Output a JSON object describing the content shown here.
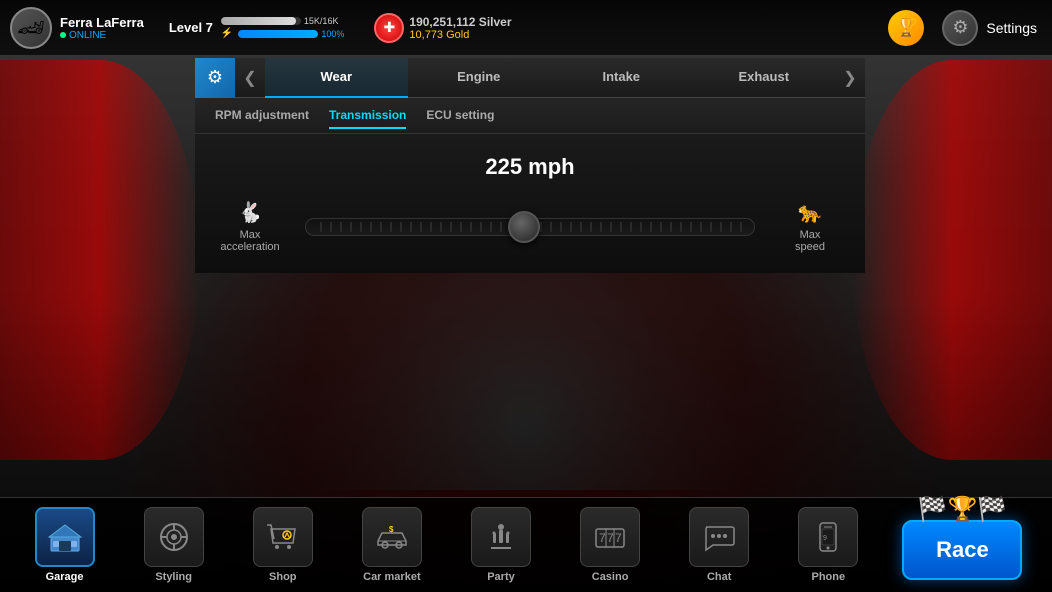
{
  "header": {
    "player": {
      "name": "Ferra LaFerra",
      "status": "ONLINE",
      "avatar_char": "🏎"
    },
    "level": {
      "label": "Level 7",
      "xp_current": "15K",
      "xp_max": "16K",
      "xp_percent": 94,
      "energy_percent": 100,
      "energy_label": "100%"
    },
    "currency": {
      "silver": "190,251,112 Silver",
      "gold": "10,773 Gold"
    },
    "settings_label": "Settings"
  },
  "tuning": {
    "gear_icon": "⚙",
    "tabs": [
      {
        "id": "wear",
        "label": "Wear",
        "active": true
      },
      {
        "id": "engine",
        "label": "Engine",
        "active": false
      },
      {
        "id": "intake",
        "label": "Intake",
        "active": false
      },
      {
        "id": "exhaust",
        "label": "Exhaust",
        "active": false
      }
    ],
    "sub_tabs": [
      {
        "id": "rpm",
        "label": "RPM adjustment",
        "active": false
      },
      {
        "id": "transmission",
        "label": "Transmission",
        "active": true
      },
      {
        "id": "ecu",
        "label": "ECU setting",
        "active": false
      }
    ],
    "transmission": {
      "speed_value": "225 mph",
      "max_acceleration_label": "Max\nacceleration",
      "max_speed_label": "Max\nspeed"
    }
  },
  "bottom_nav": {
    "items": [
      {
        "id": "garage",
        "label": "Garage",
        "icon": "🏠",
        "active": true
      },
      {
        "id": "styling",
        "label": "Styling",
        "icon": "🔧",
        "active": false
      },
      {
        "id": "shop",
        "label": "Shop",
        "icon": "🛒",
        "active": false
      },
      {
        "id": "car_market",
        "label": "Car market",
        "icon": "🚗",
        "active": false
      },
      {
        "id": "party",
        "label": "Party",
        "icon": "🏆",
        "active": false
      },
      {
        "id": "casino",
        "label": "Casino",
        "icon": "🎰",
        "active": false
      },
      {
        "id": "chat",
        "label": "Chat",
        "icon": "💬",
        "active": false
      },
      {
        "id": "phone",
        "label": "Phone",
        "icon": "📱",
        "active": false
      }
    ],
    "race_button_label": "Race"
  }
}
